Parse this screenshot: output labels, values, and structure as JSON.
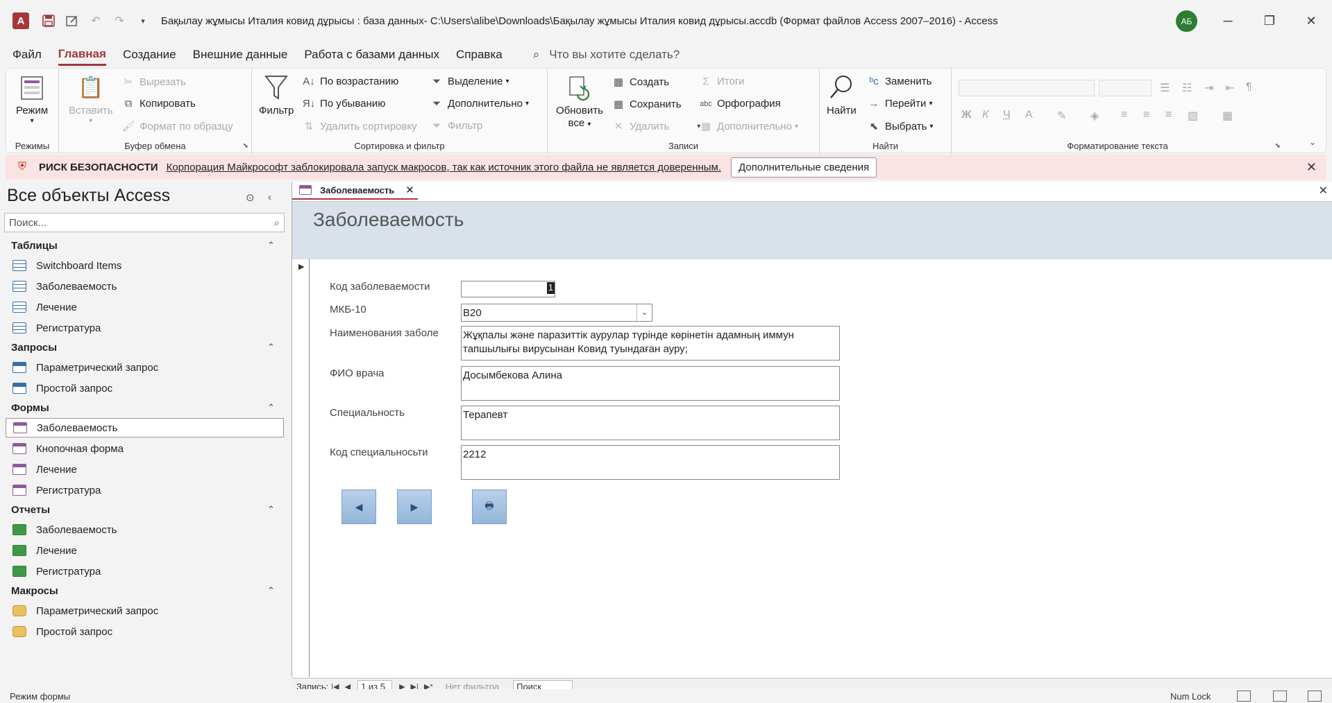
{
  "window": {
    "app_logo": "A",
    "title": "Бақылау жұмысы Италия ковид дұрысы : база данных- C:\\Users\\alibe\\Downloads\\Бақылау жұмысы Италия ковид дұрысы.accdb (Формат файлов Access 2007–2016)  -  Access",
    "user_initials": "АБ"
  },
  "menu": {
    "tabs": [
      "Файл",
      "Главная",
      "Создание",
      "Внешние данные",
      "Работа с базами данных",
      "Справка"
    ],
    "active_tab": "Главная",
    "tell_me": "Что вы хотите сделать?"
  },
  "ribbon": {
    "modes": {
      "label": "Режимы",
      "view": "Режим"
    },
    "clipboard": {
      "label": "Буфер обмена",
      "paste": "Вставить",
      "cut": "Вырезать",
      "copy": "Копировать",
      "format_painter": "Формат по образцу"
    },
    "sort": {
      "label": "Сортировка и фильтр",
      "filter": "Фильтр",
      "asc": "По возрастанию",
      "desc": "По убыванию",
      "remove_sort": "Удалить сортировку",
      "selection": "Выделение",
      "advanced": "Дополнительно",
      "toggle_filter": "Фильтр"
    },
    "records": {
      "label": "Записи",
      "refresh_1": "Обновить",
      "refresh_2": "все",
      "new": "Создать",
      "save": "Сохранить",
      "delete": "Удалить",
      "totals": "Итоги",
      "spelling": "Орфография",
      "more": "Дополнительно"
    },
    "find": {
      "label": "Найти",
      "find": "Найти",
      "replace": "Заменить",
      "goto": "Перейти",
      "select": "Выбрать"
    },
    "text_format": {
      "label": "Форматирование текста",
      "bold": "Ж",
      "italic": "К",
      "underline": "Ч"
    }
  },
  "security_bar": {
    "title": "РИСК БЕЗОПАСНОСТИ",
    "message": "Корпорация Майкрософт заблокировала запуск макросов, так как источник этого файла не является доверенным.",
    "button": "Дополнительные сведения"
  },
  "nav": {
    "title": "Все объекты Access",
    "search_placeholder": "Поиск...",
    "sections": [
      {
        "name": "Таблицы",
        "type": "table",
        "items": [
          "Switchboard Items",
          "Заболеваемость",
          "Лечение",
          "Регистратура"
        ]
      },
      {
        "name": "Запросы",
        "type": "query",
        "items": [
          "Параметрический запрос",
          "Простой запрос"
        ]
      },
      {
        "name": "Формы",
        "type": "form",
        "items": [
          "Заболеваемость",
          "Кнопочная форма",
          "Лечение",
          "Регистратура"
        ]
      },
      {
        "name": "Отчеты",
        "type": "report",
        "items": [
          "Заболеваемость",
          "Лечение",
          "Регистратура"
        ]
      },
      {
        "name": "Макросы",
        "type": "macro",
        "items": [
          "Параметрический запрос",
          "Простой запрос"
        ]
      }
    ],
    "selected": "Формы/Заболеваемость"
  },
  "document": {
    "tab_label": "Заболеваемость",
    "form_title": "Заболеваемость",
    "fields": {
      "code_label": "Код заболеваемости",
      "code_value": "1",
      "mkb_label": "МКБ-10",
      "mkb_value": "B20",
      "name_label": "Наименования заболе",
      "name_value": "Жұқпалы және паразиттік аурулар түрінде көрінетін адамның иммун тапшылығы вирусынан Ковид туындаған ауру;",
      "doctor_label": "ФИО врача",
      "doctor_value": "Досымбекова Алина",
      "spec_label": "Специальность",
      "spec_value": "Терапевт",
      "spec_code_label": "Код специальносьти",
      "spec_code_value": "2212"
    }
  },
  "record_nav": {
    "label": "Запись:",
    "position": "1 из 5",
    "filter": "Нет фильтра",
    "search": "Поиск"
  },
  "status": {
    "mode": "Режим формы",
    "num_lock": "Num Lock"
  }
}
